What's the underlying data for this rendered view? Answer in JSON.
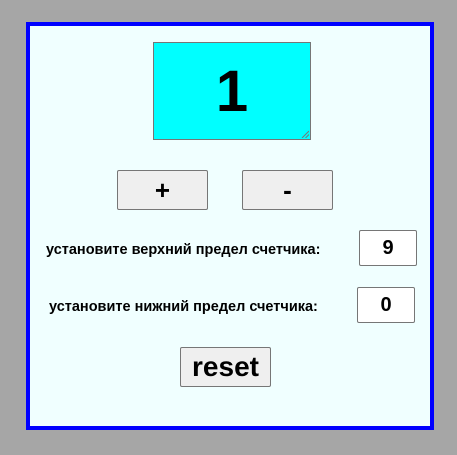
{
  "counter": {
    "value": "1",
    "display_color": "#00ffff"
  },
  "buttons": {
    "increment_label": "+",
    "decrement_label": "-",
    "reset_label": "reset"
  },
  "limits": {
    "upper_label": "установите верхний предел счетчика:",
    "upper_value": "9",
    "lower_label": "установите нижний предел счетчика:",
    "lower_value": "0"
  },
  "theme": {
    "page_background": "#a6a6a6",
    "panel_background": "#f0ffff",
    "panel_border": "#0000ff"
  },
  "icons": {
    "resize_grip": "resize-grip-icon"
  }
}
